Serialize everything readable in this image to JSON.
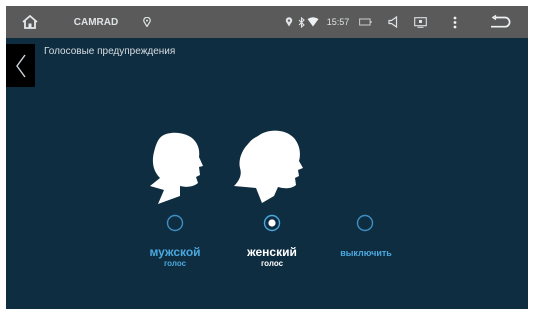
{
  "status_bar": {
    "app_name": "CAMRAD",
    "time": "15:57",
    "icons": [
      "home-icon",
      "location-icon",
      "bluetooth-icon",
      "wifi-icon",
      "battery-icon",
      "volume-icon",
      "screen-icon",
      "more-icon",
      "back-arrow-icon"
    ]
  },
  "header": {
    "title": "Голосовые предупреждения",
    "back_icon": "chevron-left-icon"
  },
  "voice_options": [
    {
      "label": "мужской",
      "sublabel": "голос",
      "selected": false,
      "icon": "male-head-icon"
    },
    {
      "label": "женский",
      "sublabel": "голос",
      "selected": true,
      "icon": "female-head-icon"
    },
    {
      "label": "выключить",
      "selected": false
    }
  ],
  "colors": {
    "background": "#0f2d40",
    "status_bar": "#5a5a5a",
    "accent": "#4aa8de",
    "selected_text": "#ffffff"
  }
}
